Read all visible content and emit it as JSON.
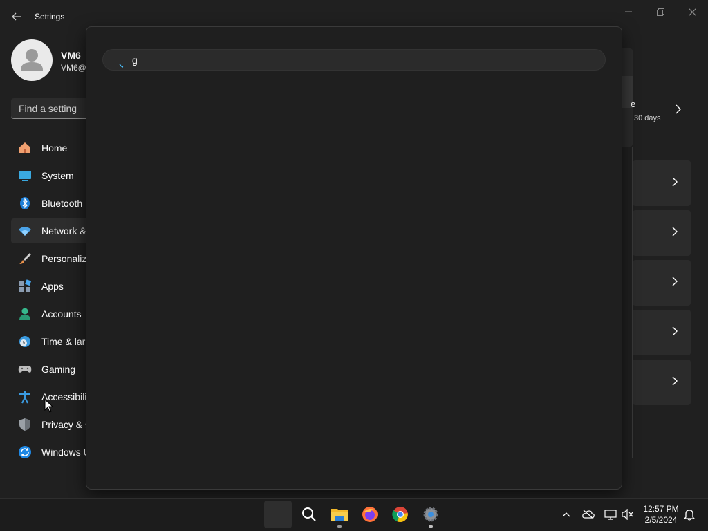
{
  "window": {
    "title": "Settings",
    "back_icon": "back-arrow-icon",
    "controls": [
      "minimize-icon",
      "maximize-icon",
      "close-icon"
    ]
  },
  "profile": {
    "name": "VM6",
    "email": "VM6@"
  },
  "sidebar": {
    "search_placeholder": "Find a setting",
    "selected_index": 3,
    "accent": "#4cc2ff",
    "items": [
      {
        "label": "Home",
        "icon": "home-icon"
      },
      {
        "label": "System",
        "icon": "system-icon"
      },
      {
        "label": "Bluetooth",
        "icon": "bluetooth-icon"
      },
      {
        "label": "Network &",
        "icon": "wifi-icon"
      },
      {
        "label": "Personaliza",
        "icon": "brush-icon"
      },
      {
        "label": "Apps",
        "icon": "apps-icon"
      },
      {
        "label": "Accounts",
        "icon": "person-icon"
      },
      {
        "label": "Time & lar",
        "icon": "clock-globe-icon"
      },
      {
        "label": "Gaming",
        "icon": "gamepad-icon"
      },
      {
        "label": "Accessibili",
        "icon": "accessibility-icon"
      },
      {
        "label": "Privacy & s",
        "icon": "shield-icon"
      },
      {
        "label": "Windows U",
        "icon": "update-icon"
      }
    ]
  },
  "content": {
    "account_card_title_fragment": "e",
    "account_card_subtitle": "30 days"
  },
  "search_popup": {
    "query": "g",
    "spinner_color": "#4cc2ff"
  },
  "taskbar": {
    "pinned": [
      "start-button",
      "search-icon",
      "file-explorer-icon",
      "firefox-icon",
      "chrome-icon",
      "settings-icon"
    ],
    "tray": [
      "show-hidden-icons-chevron",
      "onedrive-icon",
      "network-icon",
      "volume-muted-icon",
      "notifications-bell-icon"
    ],
    "time": "12:57 PM",
    "date": "2/5/2024"
  }
}
